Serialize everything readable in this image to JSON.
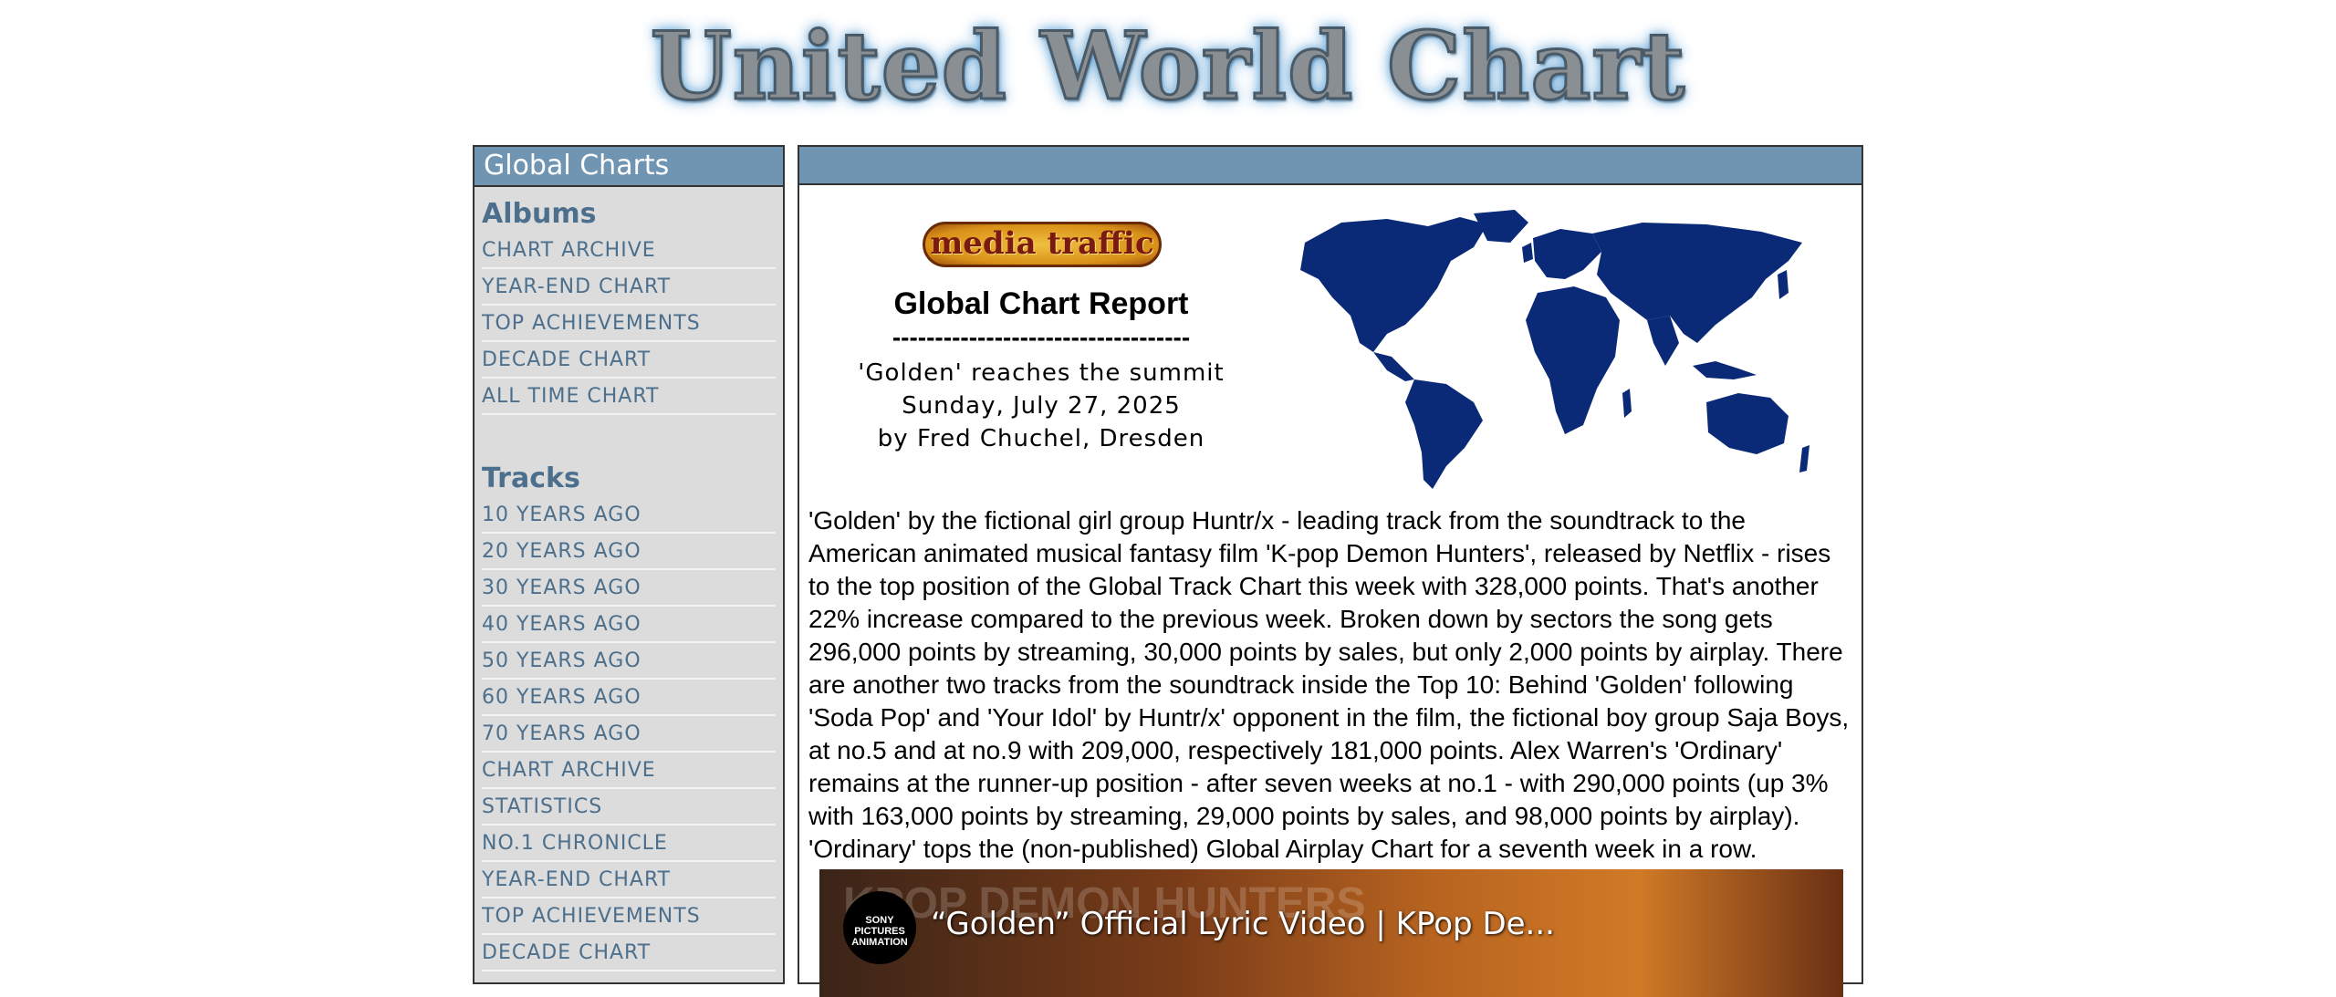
{
  "site": {
    "title": "United World Chart"
  },
  "sidebar": {
    "header": "Global Charts",
    "albums": {
      "heading": "Albums",
      "links": [
        "CHART ARCHIVE",
        "YEAR-END CHART",
        "TOP ACHIEVEMENTS",
        "DECADE CHART",
        "ALL TIME CHART"
      ]
    },
    "tracks": {
      "heading": "Tracks",
      "links": [
        "10 YEARS AGO",
        "20 YEARS AGO",
        "30 YEARS AGO",
        "40 YEARS AGO",
        "50 YEARS AGO",
        "60 YEARS AGO",
        "70 YEARS AGO",
        "CHART ARCHIVE",
        "STATISTICS",
        "NO.1 CHRONICLE",
        "YEAR-END CHART",
        "TOP ACHIEVEMENTS",
        "DECADE CHART"
      ]
    }
  },
  "main": {
    "media_logo": "media traffic",
    "report_title": "Global Chart Report",
    "report_dash": "-----------------------------------",
    "headline": "'Golden' reaches the summit",
    "date": "Sunday, July 27, 2025",
    "author": "by Fred Chuchel, Dresden",
    "article": "'Golden' by the fictional girl group Huntr/x - leading track from the soundtrack to the American animated musical fantasy film 'K-pop Demon Hunters', released by Netflix - rises to the top position of the Global Track Chart this week with 328,000 points. That's another 22% increase compared to the previous week. Broken down by sectors the song gets 296,000 points by streaming, 30,000 points by sales, but only 2,000 points by airplay. There are another two tracks from the soundtrack inside the Top 10: Behind 'Golden' following 'Soda Pop' and 'Your Idol' by Huntr/x' opponent in the film, the fictional boy group Saja Boys, at no.5 and at no.9 with 209,000, respectively 181,000 points. Alex Warren's 'Ordinary' remains at the runner-up position - after seven weeks at no.1 - with 290,000 points (up 3% with 163,000 points by streaming, 29,000 points by sales, and 98,000 points by airplay). 'Ordinary' tops the (non-published) Global Airplay Chart for a seventh week in a row.",
    "video": {
      "badge": "SONY PICTURES ANIMATION",
      "bg_text": "KPOP DEMON HUNTERS",
      "title": "“Golden” Official Lyric Video | KPop De..."
    }
  },
  "colors": {
    "header_bar": "#7095b3",
    "sidebar_bg": "#dcdcdc",
    "link": "#4b6f8c",
    "map": "#0a2a78"
  }
}
